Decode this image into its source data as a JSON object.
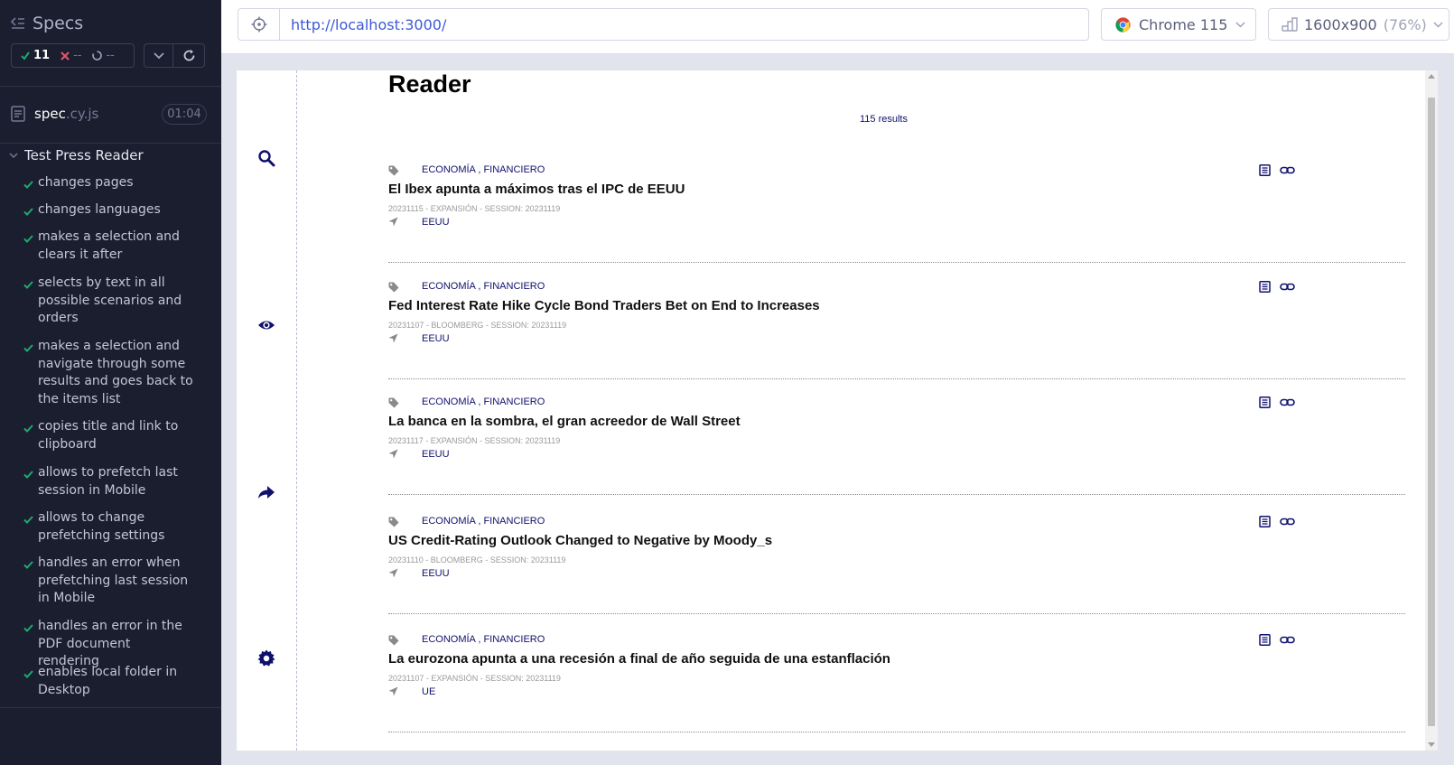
{
  "sidebar": {
    "title": "Specs",
    "stats": {
      "passed": "11",
      "failed": "--",
      "pending": "--"
    },
    "spec": {
      "name": "spec",
      "ext": ".cy.js",
      "duration": "01:04"
    },
    "suite": "Test Press Reader",
    "tests": [
      "changes pages",
      "changes languages",
      "makes a selection and clears it after",
      "selects by text in all possible scenarios and orders",
      "makes a selection and navigate through some results and goes back to the items list",
      "copies title and link to clipboard",
      "allows to prefetch last session in Mobile",
      "allows to change prefetching settings",
      "handles an error when prefetching last session in Mobile",
      "handles an error in the PDF document rendering",
      "enables local folder in Desktop"
    ]
  },
  "topbar": {
    "url": "http://localhost:3000/",
    "browser": "Chrome 115",
    "viewport": "1600x900",
    "viewport_scale": "(76%)"
  },
  "app": {
    "title": "Reader",
    "results": "115 results",
    "items": [
      {
        "categories": "ECONOMÍA , FINANCIERO",
        "title": "El Ibex apunta a máximos tras el IPC de EEUU",
        "meta": "20231115 - EXPANSIÓN - SESSION: 20231119",
        "place": "EEUU"
      },
      {
        "categories": "ECONOMÍA , FINANCIERO",
        "title": "Fed Interest Rate Hike Cycle Bond Traders Bet on End to Increases",
        "meta": "20231107 - BLOOMBERG - SESSION: 20231119",
        "place": "EEUU"
      },
      {
        "categories": "ECONOMÍA , FINANCIERO",
        "title": "La banca en la sombra, el gran acreedor de Wall Street",
        "meta": "20231117 - EXPANSIÓN - SESSION: 20231119",
        "place": "EEUU"
      },
      {
        "categories": "ECONOMÍA , FINANCIERO",
        "title": "US Credit-Rating Outlook Changed to Negative by Moody_s",
        "meta": "20231110 - BLOOMBERG - SESSION: 20231119",
        "place": "EEUU"
      },
      {
        "categories": "ECONOMÍA , FINANCIERO",
        "title": "La eurozona apunta a una recesión a final de año seguida de una estanflación",
        "meta": "20231107 - EXPANSIÓN - SESSION: 20231119",
        "place": "UE"
      }
    ]
  },
  "colors": {
    "sidebar_bg": "#1b1e2e",
    "pass": "#1fa971",
    "fail": "#e45770",
    "link": "#3d59d9",
    "app_accent": "#10106e"
  },
  "icons": [
    "collapse-icon",
    "check-icon",
    "x-icon",
    "pending-icon",
    "chevron-down-icon",
    "refresh-icon",
    "document-icon",
    "selector-icon",
    "chrome-icon",
    "viewport-icon",
    "search-icon",
    "eye-icon",
    "share-icon",
    "gear-icon",
    "tag-icon",
    "location-icon",
    "link-icon"
  ]
}
